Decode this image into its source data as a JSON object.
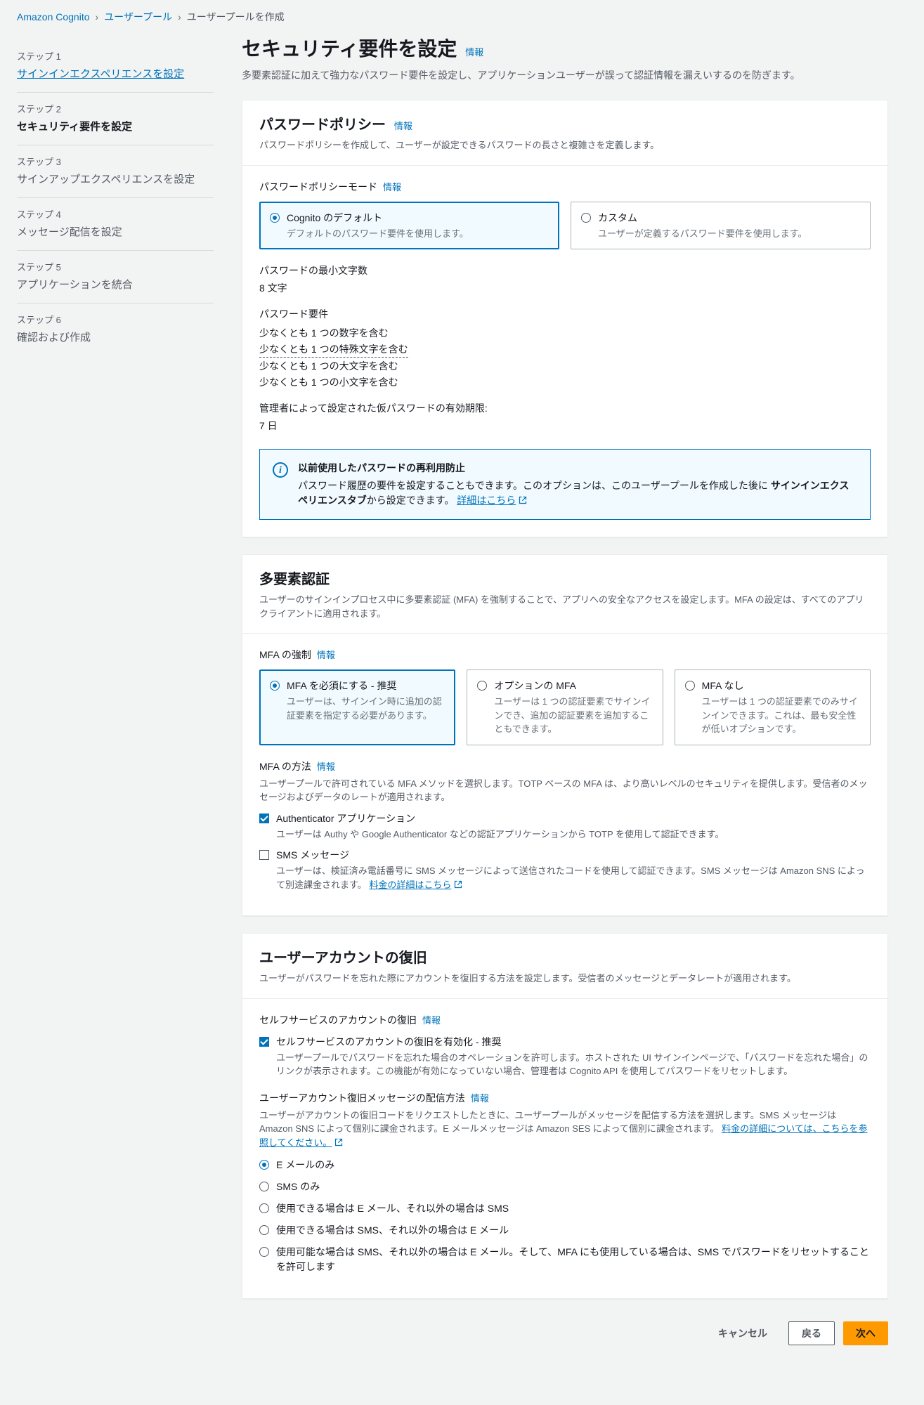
{
  "breadcrumb": {
    "items": [
      "Amazon Cognito",
      "ユーザープール",
      "ユーザープールを作成"
    ]
  },
  "sidebar": {
    "steps": [
      {
        "label": "ステップ 1",
        "title": "サインインエクスペリエンスを設定"
      },
      {
        "label": "ステップ 2",
        "title": "セキュリティ要件を設定"
      },
      {
        "label": "ステップ 3",
        "title": "サインアップエクスペリエンスを設定"
      },
      {
        "label": "ステップ 4",
        "title": "メッセージ配信を設定"
      },
      {
        "label": "ステップ 5",
        "title": "アプリケーションを統合"
      },
      {
        "label": "ステップ 6",
        "title": "確認および作成"
      }
    ]
  },
  "header": {
    "title": "セキュリティ要件を設定",
    "info": "情報",
    "desc": "多要素認証に加えて強力なパスワード要件を設定し、アプリケーションユーザーが誤って認証情報を漏えいするのを防ぎます。"
  },
  "password_policy": {
    "title": "パスワードポリシー",
    "info": "情報",
    "desc": "パスワードポリシーを作成して、ユーザーが設定できるパスワードの長さと複雑さを定義します。",
    "mode_label": "パスワードポリシーモード",
    "mode_info": "情報",
    "options": [
      {
        "title": "Cognito のデフォルト",
        "desc": "デフォルトのパスワード要件を使用します。"
      },
      {
        "title": "カスタム",
        "desc": "ユーザーが定義するパスワード要件を使用します。"
      }
    ],
    "min_length_label": "パスワードの最小文字数",
    "min_length_value": "8 文字",
    "req_label": "パスワード要件",
    "reqs": [
      "少なくとも 1 つの数字を含む",
      "少なくとも 1 つの特殊文字を含む",
      "少なくとも 1 つの大文字を含む",
      "少なくとも 1 つの小文字を含む"
    ],
    "temp_label": "管理者によって設定された仮パスワードの有効期限:",
    "temp_value": "7 日",
    "alert": {
      "title": "以前使用したパスワードの再利用防止",
      "body_a": "パスワード履歴の要件を設定することもできます。このオプションは、このユーザープールを作成した後に",
      "body_b": "サインインエクスペリエンスタブ",
      "body_c": "から設定できます。",
      "link": "詳細はこちら"
    }
  },
  "mfa": {
    "title": "多要素認証",
    "desc": "ユーザーのサインインプロセス中に多要素認証 (MFA) を強制することで、アプリへの安全なアクセスを設定します。MFA の設定は、すべてのアプリクライアントに適用されます。",
    "enforce_label": "MFA の強制",
    "enforce_info": "情報",
    "options": [
      {
        "title": "MFA を必須にする - 推奨",
        "desc": "ユーザーは、サインイン時に追加の認証要素を指定する必要があります。"
      },
      {
        "title": "オプションの MFA",
        "desc": "ユーザーは 1 つの認証要素でサインインでき、追加の認証要素を追加することもできます。"
      },
      {
        "title": "MFA なし",
        "desc": "ユーザーは 1 つの認証要素でのみサインインできます。これは、最も安全性が低いオプションです。"
      }
    ],
    "methods_label": "MFA の方法",
    "methods_info": "情報",
    "methods_desc": "ユーザープールで許可されている MFA メソッドを選択します。TOTP ベースの MFA は、より高いレベルのセキュリティを提供します。受信者のメッセージおよびデータのレートが適用されます。",
    "auth_app_title": "Authenticator アプリケーション",
    "auth_app_desc": "ユーザーは Authy や Google Authenticator などの認証アプリケーションから TOTP を使用して認証できます。",
    "sms_title": "SMS メッセージ",
    "sms_desc_a": "ユーザーは、検証済み電話番号に SMS メッセージによって送信されたコードを使用して認証できます。SMS メッセージは Amazon SNS によって別途課金されます。",
    "sms_link": "料金の詳細はこちら"
  },
  "recovery": {
    "title": "ユーザーアカウントの復旧",
    "desc": "ユーザーがパスワードを忘れた際にアカウントを復旧する方法を設定します。受信者のメッセージとデータレートが適用されます。",
    "self_label": "セルフサービスのアカウントの復旧",
    "self_info": "情報",
    "enable_title": "セルフサービスのアカウントの復旧を有効化 - 推奨",
    "enable_desc": "ユーザープールでパスワードを忘れた場合のオペレーションを許可します。ホストされた UI サインインページで、「パスワードを忘れた場合」のリンクが表示されます。この機能が有効になっていない場合、管理者は Cognito API を使用してパスワードをリセットします。",
    "delivery_label": "ユーザーアカウント復旧メッセージの配信方法",
    "delivery_info": "情報",
    "delivery_desc_a": "ユーザーがアカウントの復旧コードをリクエストしたときに、ユーザープールがメッセージを配信する方法を選択します。SMS メッセージは Amazon SNS によって個別に課金されます。E メールメッセージは Amazon SES によって個別に課金されます。",
    "delivery_link": "料金の詳細については、こちらを参照してください。",
    "delivery_options": [
      "E メールのみ",
      "SMS のみ",
      "使用できる場合は E メール、それ以外の場合は SMS",
      "使用できる場合は SMS、それ以外の場合は E メール",
      "使用可能な場合は SMS、それ以外の場合は E メール。そして、MFA にも使用している場合は、SMS でパスワードをリセットすることを許可します"
    ]
  },
  "footer": {
    "cancel": "キャンセル",
    "back": "戻る",
    "next": "次へ"
  }
}
